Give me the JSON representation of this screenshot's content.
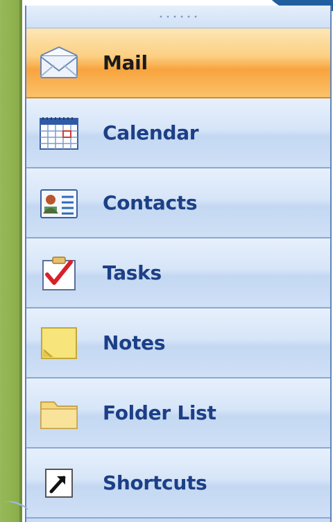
{
  "colors": {
    "accent_green": "#8fb24e",
    "pane_blue": "#c9dcf4",
    "label_blue": "#1c3f86",
    "active_orange": "#f8a43e"
  },
  "nav": {
    "items": [
      {
        "label": "Mail",
        "icon": "mail-envelope-icon",
        "active": true
      },
      {
        "label": "Calendar",
        "icon": "calendar-icon",
        "active": false
      },
      {
        "label": "Contacts",
        "icon": "contact-card-icon",
        "active": false
      },
      {
        "label": "Tasks",
        "icon": "task-checkmark-icon",
        "active": false
      },
      {
        "label": "Notes",
        "icon": "note-icon",
        "active": false
      },
      {
        "label": "Folder List",
        "icon": "folder-icon",
        "active": false
      },
      {
        "label": "Shortcuts",
        "icon": "shortcut-arrow-icon",
        "active": false
      }
    ]
  }
}
